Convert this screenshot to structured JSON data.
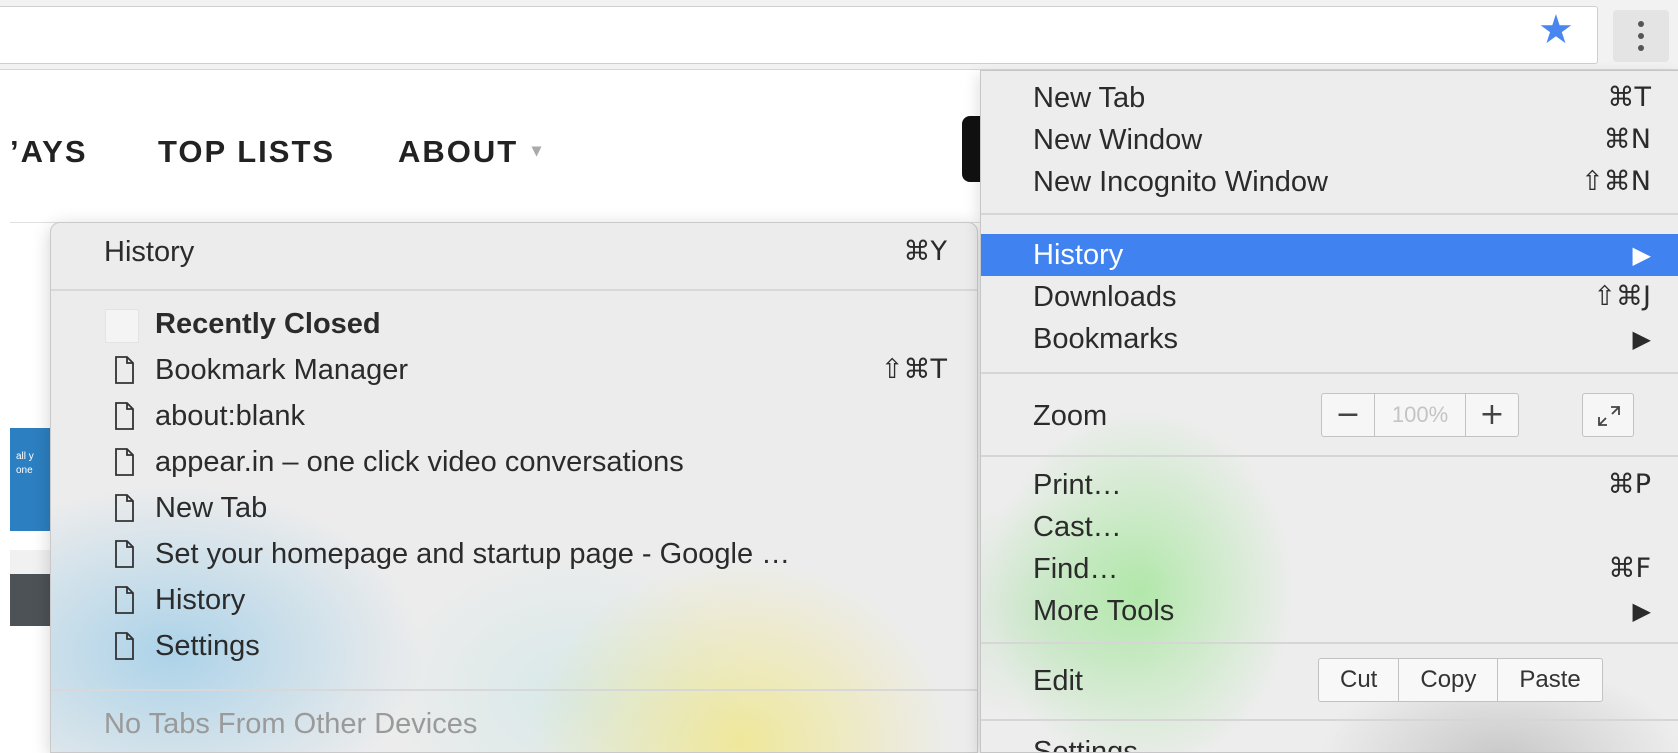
{
  "toolbar": {
    "star_icon": "star-icon",
    "menu_icon": "kebab-menu-icon",
    "star_color": "#4a86f0"
  },
  "page": {
    "nav": {
      "ways": "’AYS",
      "top_lists": "TOP LISTS",
      "about": "ABOUT",
      "about_caret": "▾"
    },
    "banner_text": "all y\none"
  },
  "history_submenu": {
    "header": {
      "label": "History",
      "shortcut": "⌘Y"
    },
    "recently_closed_label": "Recently Closed",
    "items": [
      {
        "label": "Bookmark Manager",
        "shortcut": "⇧⌘T"
      },
      {
        "label": "about:blank",
        "shortcut": ""
      },
      {
        "label": "appear.in – one click video conversations",
        "shortcut": ""
      },
      {
        "label": "New Tab",
        "shortcut": ""
      },
      {
        "label": "Set your homepage and startup page - Google …",
        "shortcut": ""
      },
      {
        "label": "History",
        "shortcut": ""
      },
      {
        "label": "Settings",
        "shortcut": ""
      }
    ],
    "no_tabs_label": "No Tabs From Other Devices"
  },
  "main_menu": {
    "new_tab": {
      "label": "New Tab",
      "shortcut": "⌘T"
    },
    "new_window": {
      "label": "New Window",
      "shortcut": "⌘N"
    },
    "new_incognito": {
      "label": "New Incognito Window",
      "shortcut": "⇧⌘N"
    },
    "history": {
      "label": "History",
      "arrow": "▶"
    },
    "downloads": {
      "label": "Downloads",
      "shortcut": "⇧⌘J"
    },
    "bookmarks": {
      "label": "Bookmarks",
      "arrow": "▶"
    },
    "zoom": {
      "label": "Zoom",
      "minus": "−",
      "value": "100%",
      "plus": "+"
    },
    "print": {
      "label": "Print…",
      "shortcut": "⌘P"
    },
    "cast": {
      "label": "Cast…"
    },
    "find": {
      "label": "Find…",
      "shortcut": "⌘F"
    },
    "more_tools": {
      "label": "More Tools",
      "arrow": "▶"
    },
    "edit": {
      "label": "Edit",
      "cut": "Cut",
      "copy": "Copy",
      "paste": "Paste"
    },
    "settings": {
      "label": "Settings"
    },
    "selected_color": "#3f82f0"
  }
}
